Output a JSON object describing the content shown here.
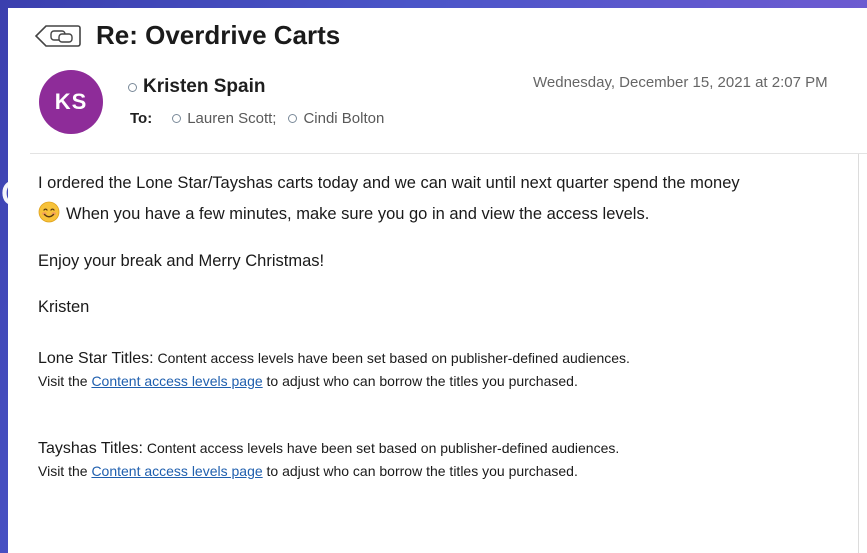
{
  "message": {
    "subject": "Re: Overdrive Carts",
    "avatar_initials": "KS",
    "avatar_color": "#8e2c99",
    "sender": "Kristen Spain",
    "to_label": "To:",
    "recipients": [
      "Lauren Scott;",
      "Cindi Bolton"
    ],
    "date": "Wednesday, December 15, 2021 at 2:07 PM"
  },
  "body": {
    "line1": "I ordered the Lone Star/Tayshas carts today and we can wait until next quarter spend the money",
    "emoji": "smiling-face-icon",
    "line2": "When you have a few minutes, make sure you go in and view the access levels.",
    "greeting": "Enjoy your break and Merry Christmas!",
    "signature": "Kristen",
    "sections": [
      {
        "label": "Lone Star Titles:",
        "text": " Content access levels have been set based on publisher-defined audiences.",
        "visit": "Visit the ",
        "link": "Content access levels page",
        "tail": " to adjust who can borrow the titles you purchased."
      },
      {
        "label": "Tayshas Titles:",
        "text": " Content access levels have been set based on publisher-defined audiences.",
        "visit": "Visit the ",
        "link": "Content access levels page",
        "tail": " to adjust who can borrow the titles you purchased."
      }
    ]
  },
  "colors": {
    "accent_link": "#1f5fae",
    "background": "#4a55c8"
  }
}
